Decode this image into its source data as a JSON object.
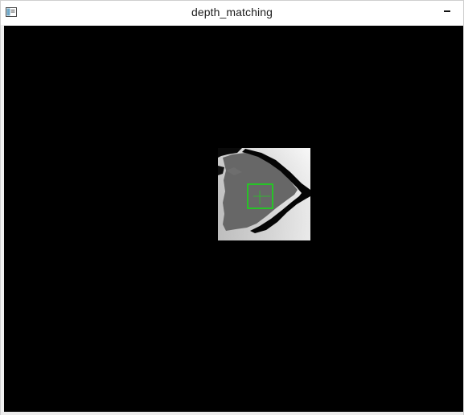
{
  "window": {
    "title": "depth_matching",
    "app_icon": "window-app-icon",
    "minimize_icon": "minimize-icon"
  },
  "colors": {
    "viewport_bg": "#000000",
    "match_box": "#22cc22",
    "crosshair": "#22cc22"
  }
}
